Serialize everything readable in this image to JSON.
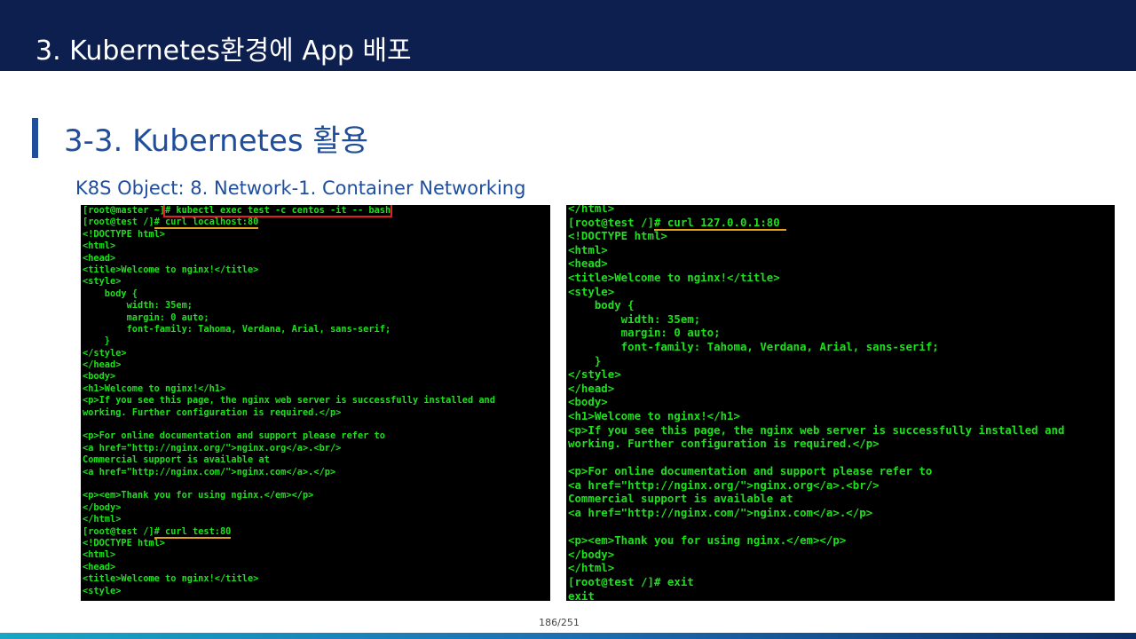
{
  "header": {
    "title": "3.   Kubernetes환경에 App 배포"
  },
  "section": {
    "title": "3-3. Kubernetes 활용",
    "subtitle": "K8S Object: 8. Network-1. Container Networking"
  },
  "terminal_left": {
    "lines": [
      {
        "prompt": "[root@master ~]",
        "cmd": "# kubectl exec test -c centos -it -- bash",
        "style": "box-red"
      },
      {
        "prompt": "[root@test /]",
        "cmd": "# curl localhost:80",
        "style": "u-orange"
      },
      {
        "text": "<!DOCTYPE html>"
      },
      {
        "text": "<html>"
      },
      {
        "text": "<head>"
      },
      {
        "text": "<title>Welcome to nginx!</title>"
      },
      {
        "text": "<style>"
      },
      {
        "text": "    body {"
      },
      {
        "text": "        width: 35em;"
      },
      {
        "text": "        margin: 0 auto;"
      },
      {
        "text": "        font-family: Tahoma, Verdana, Arial, sans-serif;"
      },
      {
        "text": "    }"
      },
      {
        "text": "</style>"
      },
      {
        "text": "</head>"
      },
      {
        "text": "<body>"
      },
      {
        "text": "<h1>Welcome to nginx!</h1>"
      },
      {
        "text": "<p>If you see this page, the nginx web server is successfully installed and"
      },
      {
        "text": "working. Further configuration is required.</p>"
      },
      {
        "text": ""
      },
      {
        "text": "<p>For online documentation and support please refer to"
      },
      {
        "text": "<a href=\"http://nginx.org/\">nginx.org</a>.<br/>"
      },
      {
        "text": "Commercial support is available at"
      },
      {
        "text": "<a href=\"http://nginx.com/\">nginx.com</a>.</p>"
      },
      {
        "text": ""
      },
      {
        "text": "<p><em>Thank you for using nginx.</em></p>"
      },
      {
        "text": "</body>"
      },
      {
        "text": "</html>"
      },
      {
        "prompt": "[root@test /]",
        "cmd": "# curl test:80",
        "style": "u-orange"
      },
      {
        "text": "<!DOCTYPE html>"
      },
      {
        "text": "<html>"
      },
      {
        "text": "<head>"
      },
      {
        "text": "<title>Welcome to nginx!</title>"
      },
      {
        "text": "<style>"
      }
    ]
  },
  "terminal_right": {
    "lines": [
      {
        "text": "</html>"
      },
      {
        "prompt": "[root@test /]",
        "cmd": "# curl 127.0.0.1:80 ",
        "style": "u-orange"
      },
      {
        "text": "<!DOCTYPE html>"
      },
      {
        "text": "<html>"
      },
      {
        "text": "<head>"
      },
      {
        "text": "<title>Welcome to nginx!</title>"
      },
      {
        "text": "<style>"
      },
      {
        "text": "    body {"
      },
      {
        "text": "        width: 35em;"
      },
      {
        "text": "        margin: 0 auto;"
      },
      {
        "text": "        font-family: Tahoma, Verdana, Arial, sans-serif;"
      },
      {
        "text": "    }"
      },
      {
        "text": "</style>"
      },
      {
        "text": "</head>"
      },
      {
        "text": "<body>"
      },
      {
        "text": "<h1>Welcome to nginx!</h1>"
      },
      {
        "text": "<p>If you see this page, the nginx web server is successfully installed and"
      },
      {
        "text": "working. Further configuration is required.</p>"
      },
      {
        "text": ""
      },
      {
        "text": "<p>For online documentation and support please refer to"
      },
      {
        "text": "<a href=\"http://nginx.org/\">nginx.org</a>.<br/>"
      },
      {
        "text": "Commercial support is available at"
      },
      {
        "text": "<a href=\"http://nginx.com/\">nginx.com</a>.</p>"
      },
      {
        "text": ""
      },
      {
        "text": "<p><em>Thank you for using nginx.</em></p>"
      },
      {
        "text": "</body>"
      },
      {
        "text": "</html>"
      },
      {
        "text": "[root@test /]# exit"
      },
      {
        "text": "exit"
      }
    ]
  },
  "footer": {
    "page_number": "186/251"
  },
  "colors": {
    "header_bg": "#0c1f4f",
    "title_blue": "#1f4e9c",
    "terminal_text": "#1ee01e",
    "highlight_orange": "#e0a020",
    "highlight_red": "#e02020"
  }
}
